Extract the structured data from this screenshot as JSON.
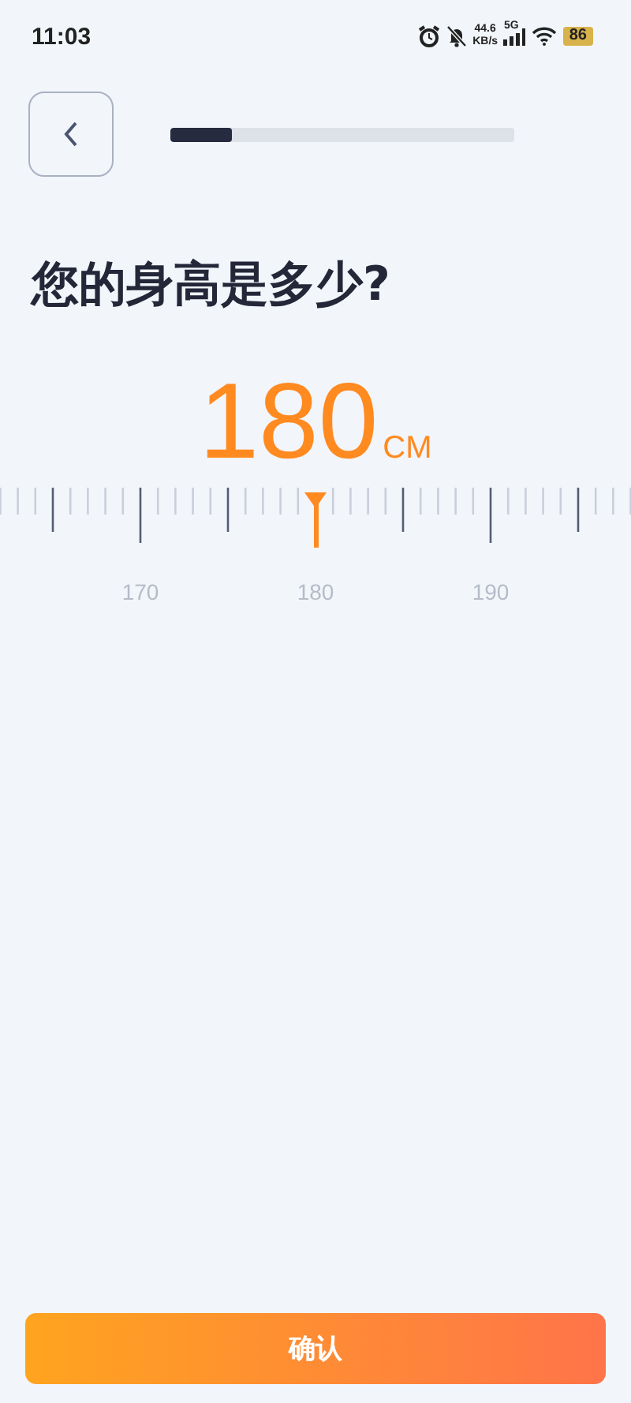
{
  "status_bar": {
    "time": "11:03",
    "net_speed": "44.6",
    "net_unit": "KB/s",
    "network": "5G",
    "battery": "86"
  },
  "progress": {
    "level": 0.18
  },
  "title": "您的身高是多少?",
  "value": {
    "number": "180",
    "unit": "CM"
  },
  "ruler": {
    "labels": [
      "170",
      "180",
      "190"
    ]
  },
  "button": {
    "label": "确认"
  }
}
